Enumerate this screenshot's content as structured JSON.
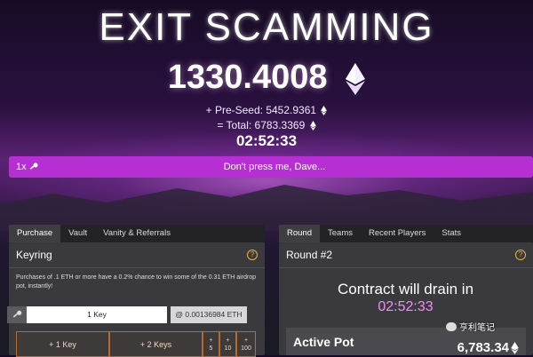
{
  "hero": {
    "title": "EXIT SCAMMING",
    "pot_value": "1330.4008",
    "preseed_label": "+ Pre-Seed: 5452.9361",
    "total_label": "= Total: 6783.3369",
    "timer": "02:52:33"
  },
  "warning_bar": {
    "multiplier": "1x",
    "text": "Don't press me, Dave..."
  },
  "purchase_panel": {
    "tabs": [
      {
        "label": "Purchase",
        "active": true
      },
      {
        "label": "Vault",
        "active": false
      },
      {
        "label": "Vanity & Referrals",
        "active": false
      }
    ],
    "header": "Keyring",
    "help": "?",
    "promo_text": "Purchases of .1 ETH or more have a 0.2% chance to win some of the 0.31 ETH airdrop pot, instantly!",
    "key_input_value": "1 Key",
    "cost_text": "@ 0.00136984 ETH",
    "buy_buttons": [
      "+ 1 Key",
      "+ 2 Keys"
    ],
    "quick_add": [
      {
        "plus": "+",
        "amount": "5"
      },
      {
        "plus": "+",
        "amount": "10"
      },
      {
        "plus": "+",
        "amount": "100"
      }
    ]
  },
  "round_panel": {
    "tabs": [
      {
        "label": "Round",
        "active": true
      },
      {
        "label": "Teams",
        "active": false
      },
      {
        "label": "Recent Players",
        "active": false
      },
      {
        "label": "Stats",
        "active": false
      }
    ],
    "header": "Round #2",
    "help": "?",
    "drain_text": "Contract will drain in",
    "drain_timer": "02:52:33",
    "active_pot_label": "Active Pot",
    "active_pot_value": "6,783.34"
  },
  "watermark": "亨利笔记",
  "colors": {
    "accent_magenta": "#b52fd3",
    "timer_pink": "#f28df5",
    "button_border_orange": "#b66a2d",
    "help_yellow": "#e8b23a"
  }
}
